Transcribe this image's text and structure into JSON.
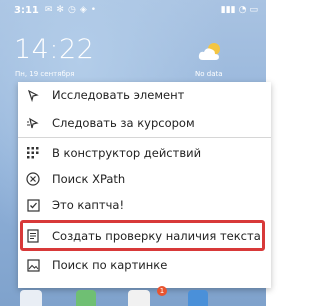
{
  "status_bar": {
    "time": "3:11"
  },
  "lock": {
    "clock": "14:22",
    "date": "Пн, 19 сентября",
    "weather_text": "No data"
  },
  "menu": {
    "items": [
      {
        "label": "Исследовать элемент",
        "icon": "cursor-icon"
      },
      {
        "label": "Следовать за курсором",
        "icon": "follow-cursor-icon"
      },
      {
        "label": "В конструктор действий",
        "icon": "grid-icon"
      },
      {
        "label": "Поиск XPath",
        "icon": "x-circle-icon"
      },
      {
        "label": "Это каптча!",
        "icon": "captcha-icon"
      },
      {
        "label": "Создать проверку наличия текста",
        "icon": "document-icon"
      },
      {
        "label": "Поиск по картинке",
        "icon": "image-icon"
      }
    ],
    "highlighted_index": 5
  },
  "dock": {
    "badge": "1"
  },
  "colors": {
    "highlight": "#d83939",
    "accent_wallpaper": "#8fb0d8"
  }
}
